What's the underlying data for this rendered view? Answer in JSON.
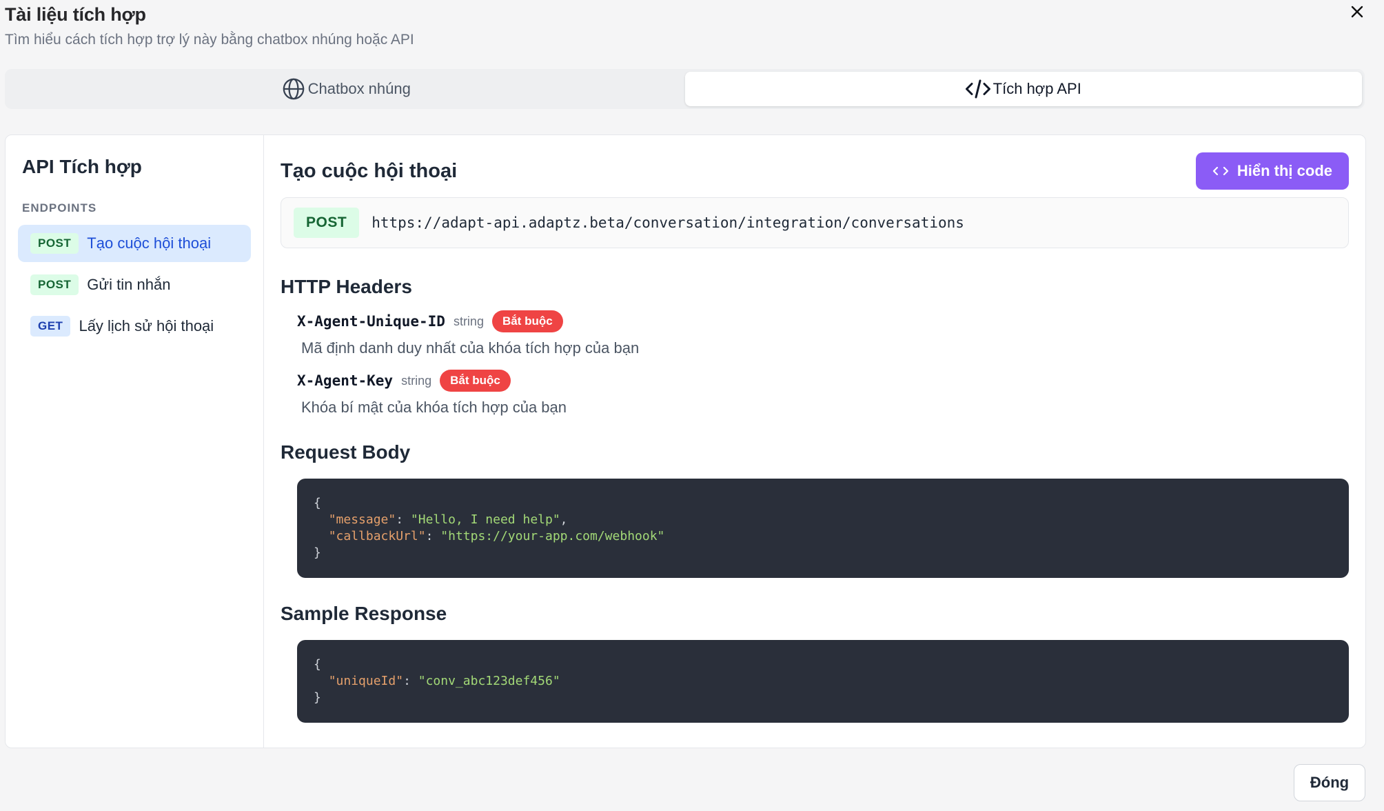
{
  "dialog": {
    "title": "Tài liệu tích hợp",
    "subtitle": "Tìm hiểu cách tích hợp trợ lý này bằng chatbox nhúng hoặc API",
    "close_icon": "close-icon"
  },
  "tabs": [
    {
      "label": "Chatbox nhúng",
      "icon": "globe-icon",
      "active": false
    },
    {
      "label": "Tích hợp API",
      "icon": "code-icon",
      "active": true
    }
  ],
  "sidebar": {
    "title": "API Tích hợp",
    "section": "ENDPOINTS",
    "endpoints": [
      {
        "method": "POST",
        "label": "Tạo cuộc hội thoại",
        "active": true
      },
      {
        "method": "POST",
        "label": "Gửi tin nhắn",
        "active": false
      },
      {
        "method": "GET",
        "label": "Lấy lịch sử hội thoại",
        "active": false
      }
    ]
  },
  "main": {
    "title": "Tạo cuộc hội thoại",
    "show_code_label": "Hiển thị code",
    "method": "POST",
    "url": "https://adapt-api.adaptz.beta/conversation/integration/conversations",
    "headers_title": "HTTP Headers",
    "headers": [
      {
        "name": "X-Agent-Unique-ID",
        "type": "string",
        "badge": "Bắt buộc",
        "desc": "Mã định danh duy nhất của khóa tích hợp của bạn"
      },
      {
        "name": "X-Agent-Key",
        "type": "string",
        "badge": "Bắt buộc",
        "desc": "Khóa bí mật của khóa tích hợp của bạn"
      }
    ],
    "body_title": "Request Body",
    "body_code": {
      "open": "{",
      "key1": "\"message\"",
      "val1": "\"Hello, I need help\"",
      "key2": "\"callbackUrl\"",
      "val2": "\"https://your-app.com/webhook\"",
      "close": "}"
    },
    "response_title": "Sample Response",
    "response_code": {
      "open": "{",
      "key1": "\"uniqueId\"",
      "val1": "\"conv_abc123def456\"",
      "close": "}"
    }
  },
  "footer": {
    "close_label": "Đóng"
  },
  "colors": {
    "accent": "#8b5cf6",
    "required": "#ef4444",
    "post_bg": "#dcfce7",
    "get_bg": "#dbeafe",
    "code_bg": "#2a2f3a"
  }
}
